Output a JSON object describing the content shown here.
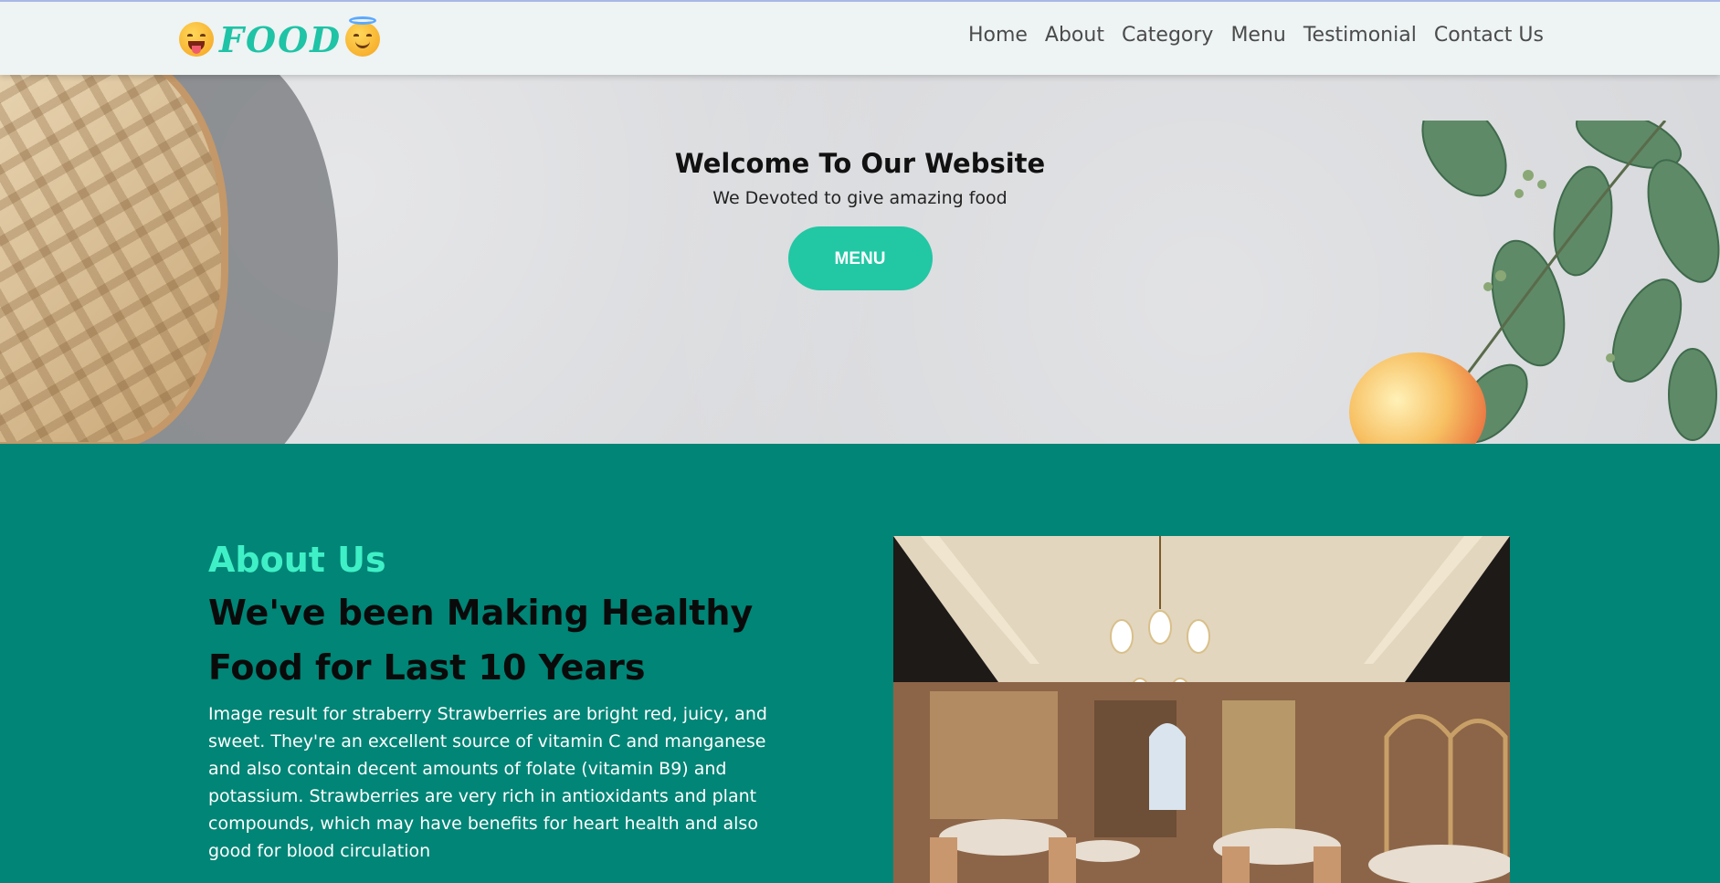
{
  "brand": {
    "name": "FOOD",
    "left_icon": "yum-face-icon",
    "right_icon": "halo-face-icon",
    "color": "#1fc3a6"
  },
  "nav": {
    "items": [
      {
        "label": "Home"
      },
      {
        "label": "About"
      },
      {
        "label": "Category"
      },
      {
        "label": "Menu"
      },
      {
        "label": "Testimonial"
      },
      {
        "label": "Contact Us"
      }
    ]
  },
  "hero": {
    "title": "Welcome To Our Website",
    "subtitle": "We Devoted to give amazing food",
    "button_label": "MENU",
    "button_color": "#22c7a4"
  },
  "about": {
    "tag": "About Us",
    "heading": "We've been Making Healthy Food for Last 10 Years",
    "text": "Image result for straberry Strawberries are bright red, juicy, and sweet. They're an excellent source of vitamin C and manganese and also contain decent amounts of folate (vitamin B9) and potassium. Strawberries are very rich in antioxidants and plant compounds, which may have benefits for heart health and also good for blood circulation",
    "background_color": "#008576",
    "tag_color": "#3ff0c7"
  }
}
